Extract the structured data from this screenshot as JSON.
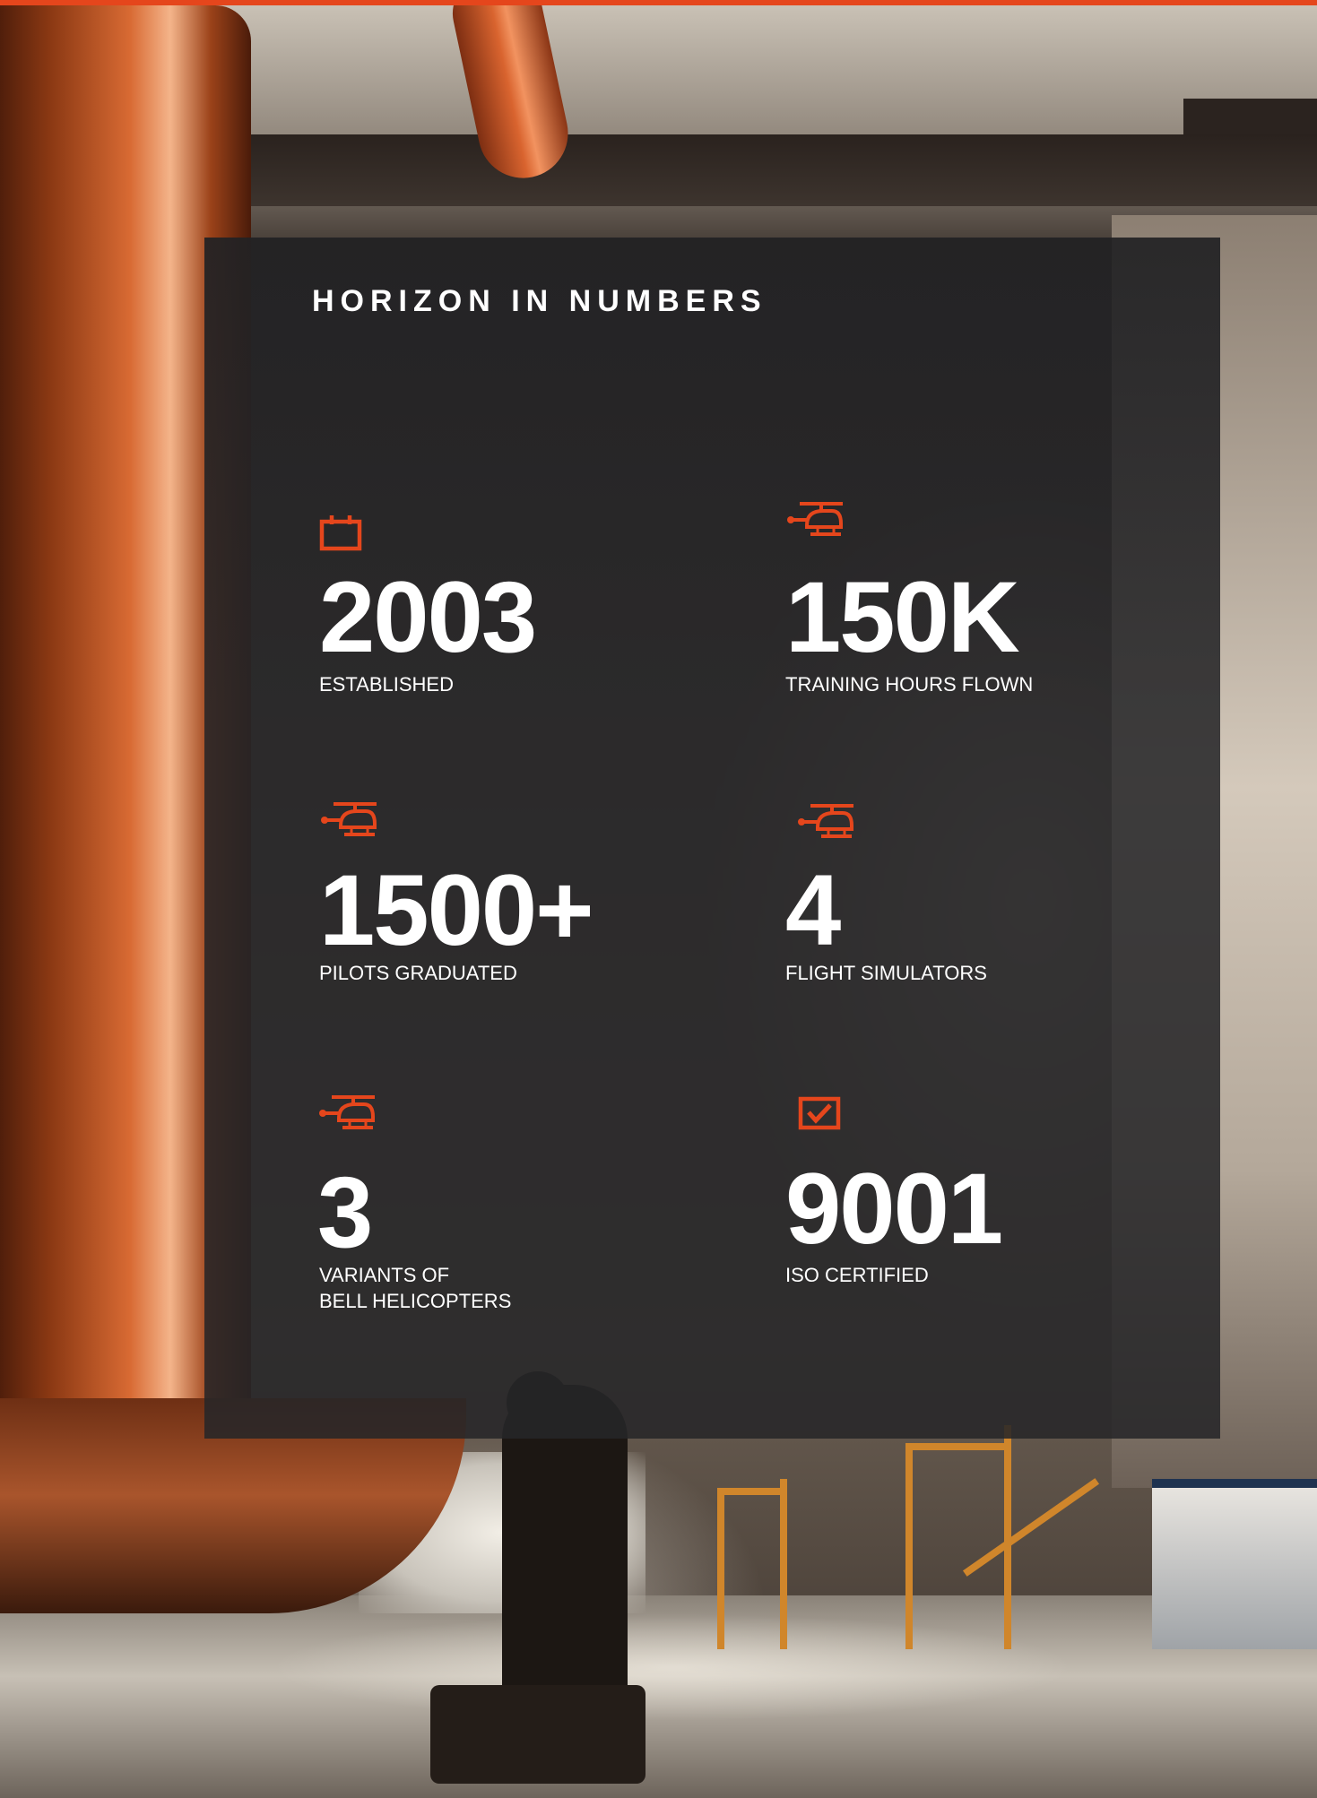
{
  "header": {
    "title": "HORIZON IN NUMBERS"
  },
  "accent_color": "#e5461c",
  "stats": [
    {
      "icon": "calendar-icon",
      "number": "2003",
      "label_lines": [
        "ESTABLISHED"
      ]
    },
    {
      "icon": "helicopter-icon",
      "number": "150K",
      "label_lines": [
        "TRAINING HOURS FLOWN"
      ]
    },
    {
      "icon": "helicopter-icon",
      "number": "1500+",
      "label_lines": [
        "PILOTS GRADUATED"
      ]
    },
    {
      "icon": "helicopter-icon",
      "number": "4",
      "label_lines": [
        "FLIGHT SIMULATORS"
      ]
    },
    {
      "icon": "helicopter-icon",
      "number": "3",
      "label_lines": [
        "VARIANTS OF",
        "BELL HELICOPTERS"
      ]
    },
    {
      "icon": "checkbox-icon",
      "number": "9001",
      "label_lines": [
        "ISO CERTIFIED"
      ]
    }
  ]
}
